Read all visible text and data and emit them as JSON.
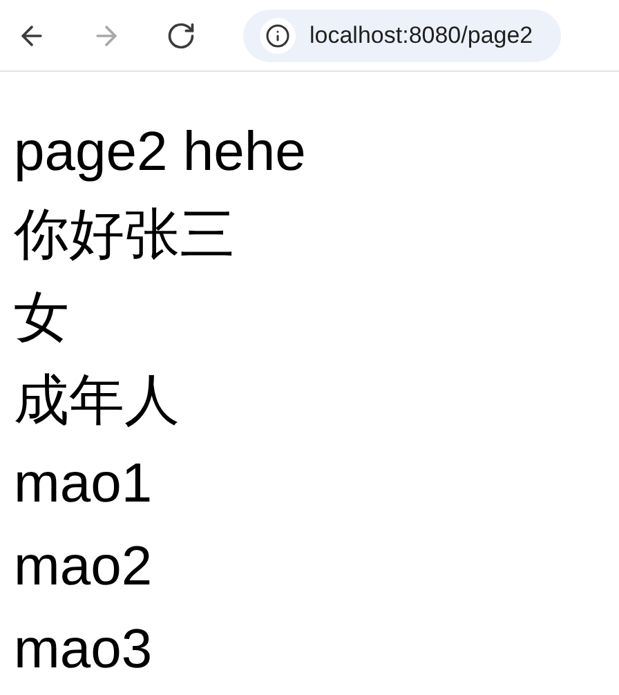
{
  "toolbar": {
    "nav_buttons": [
      {
        "kind": "back",
        "disabled": false
      },
      {
        "kind": "forward",
        "disabled": true
      },
      {
        "kind": "reload",
        "disabled": false
      }
    ],
    "address": "localhost:8080/page2"
  },
  "content": {
    "lines": [
      "page2 hehe",
      "你好张三",
      "女",
      "成年人",
      "mao1",
      "mao2",
      "mao3"
    ]
  }
}
